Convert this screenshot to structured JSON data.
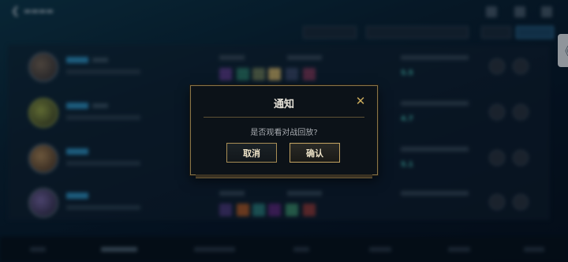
{
  "dialog": {
    "title": "通知",
    "close_glyph": "✕",
    "message": "是否观看对战回放?",
    "cancel_label": "取消",
    "confirm_label": "确认"
  },
  "background": {
    "result_badges": [
      "5.5",
      "4.7",
      "5.1",
      ""
    ],
    "side_tab_glyph": "《"
  },
  "colors": {
    "accent_gold": "#c8a95b",
    "button_border": "#a88d55",
    "dialog_bg": "#0c1218"
  },
  "icons": [
    "back-arrow-icon",
    "close-icon",
    "settings-icon",
    "list-icon"
  ]
}
